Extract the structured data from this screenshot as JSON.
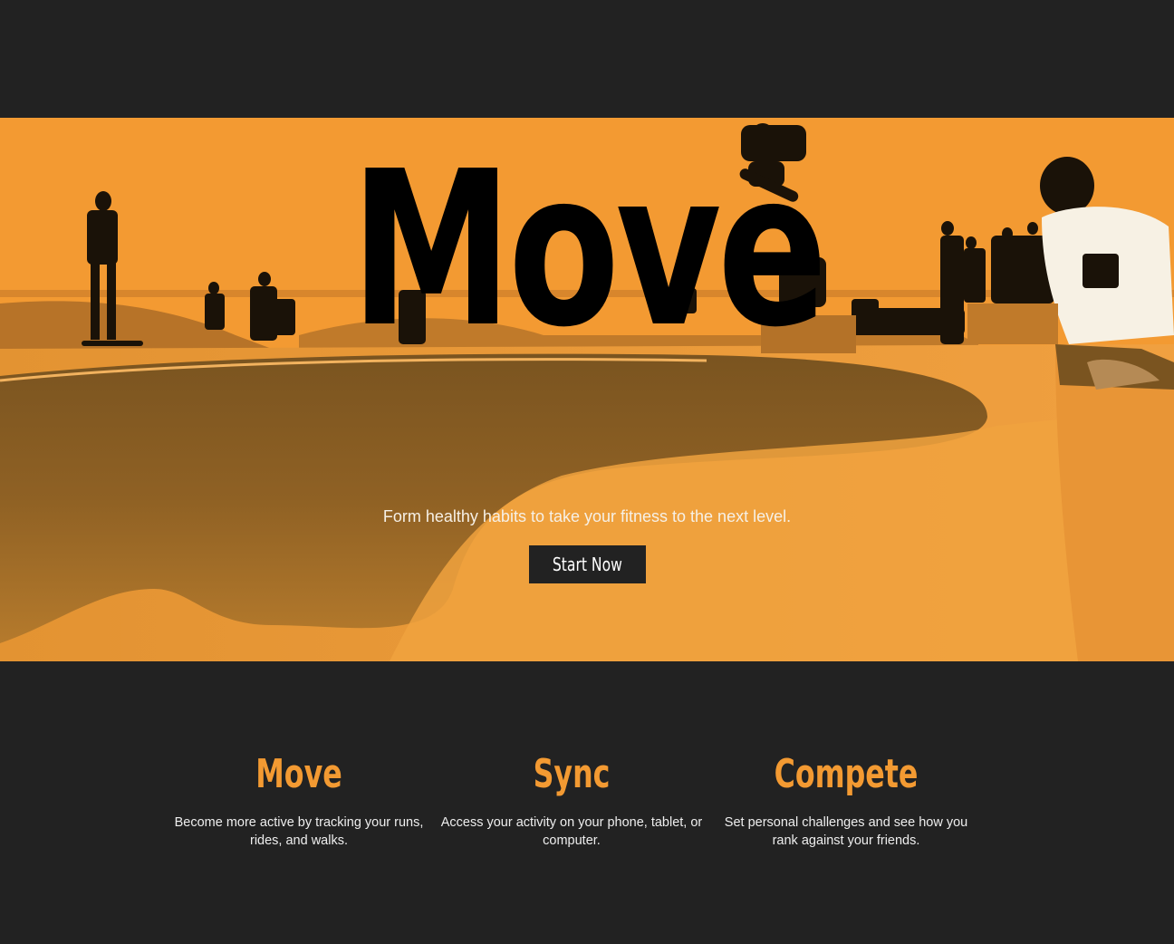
{
  "hero": {
    "title": "Move",
    "subtitle": "Form healthy habits to take your fitness to the next level.",
    "cta_label": "Start Now",
    "tint_color": "#f39a32",
    "background_image": "skatepark-photo"
  },
  "features": [
    {
      "title": "Move",
      "text": "Become more active by tracking your runs, rides, and walks."
    },
    {
      "title": "Sync",
      "text": "Access your activity on your phone, tablet, or computer."
    },
    {
      "title": "Compete",
      "text": "Set personal challenges and see how you rank against your friends."
    }
  ],
  "colors": {
    "background": "#222222",
    "accent": "#f39a32",
    "text_light": "#eeeeee"
  }
}
